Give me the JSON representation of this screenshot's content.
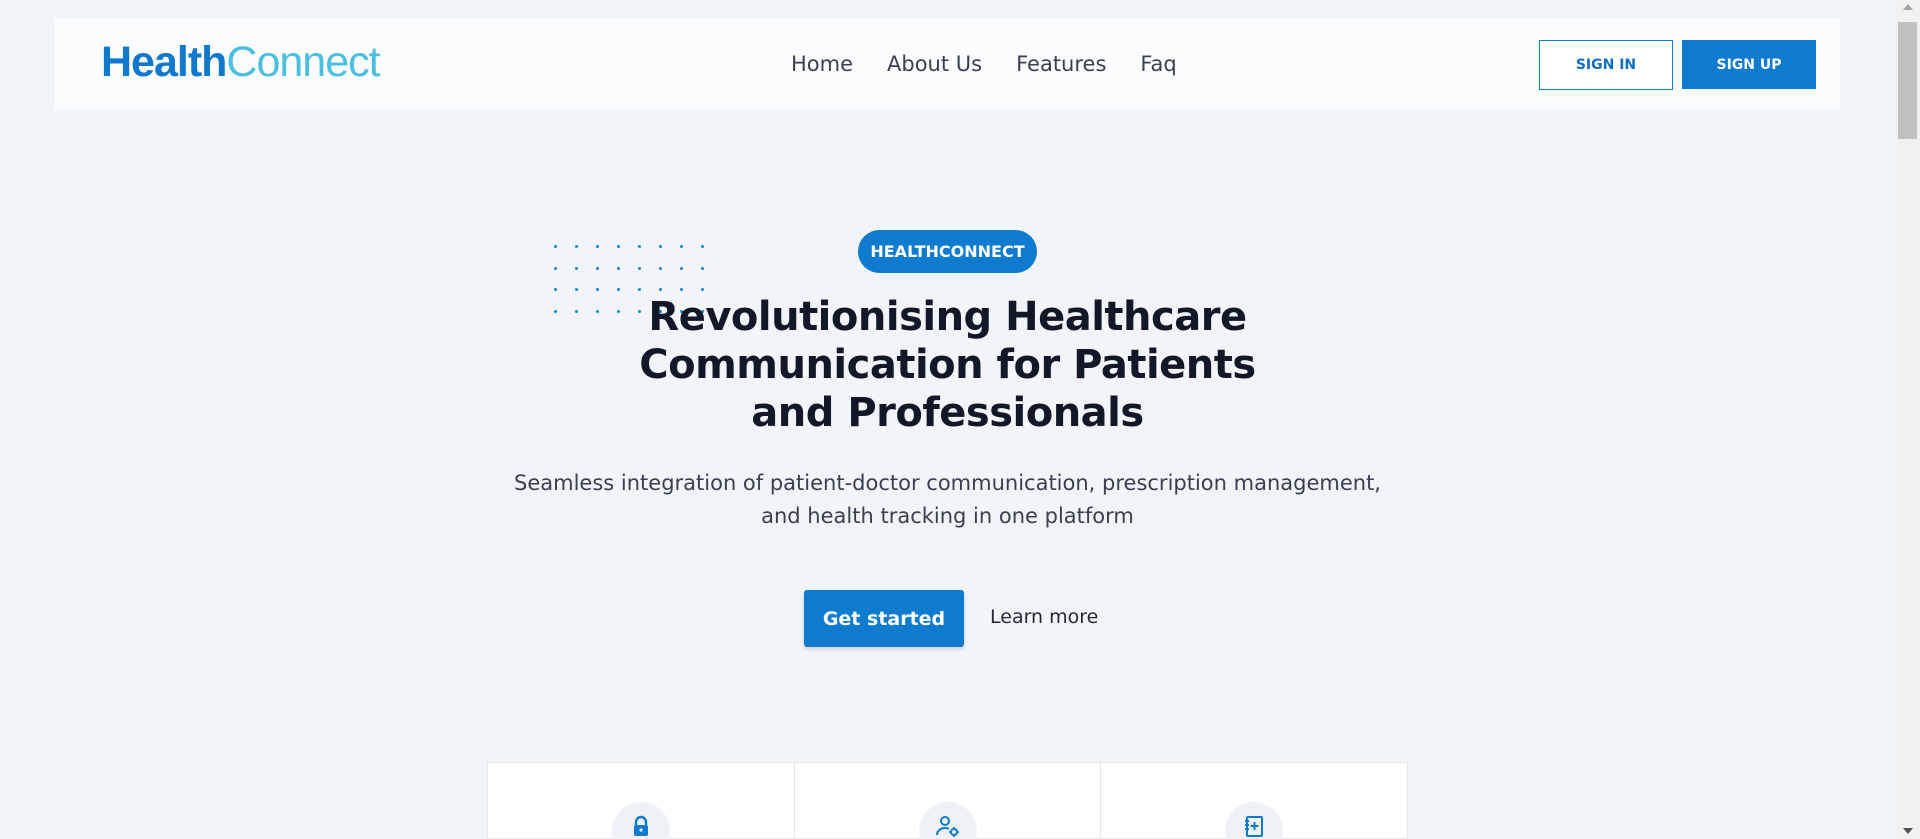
{
  "header": {
    "logo_part1": "Health",
    "logo_part2": "Connect",
    "nav": [
      {
        "label": "Home"
      },
      {
        "label": "About Us"
      },
      {
        "label": "Features"
      },
      {
        "label": "Faq"
      }
    ],
    "sign_in_label": "SIGN IN",
    "sign_up_label": "SIGN UP"
  },
  "hero": {
    "badge": "HEALTHCONNECT",
    "title_line1": "Revolutionising Healthcare",
    "title_line2": "Communication for Patients",
    "title_line3": "and Professionals",
    "subtitle_line1": "Seamless integration of patient-doctor communication, prescription management,",
    "subtitle_line2": "and health tracking in one platform",
    "primary_cta": "Get started",
    "secondary_cta": "Learn more"
  },
  "features": [
    {
      "icon": "lock-icon"
    },
    {
      "icon": "user-gear-icon"
    },
    {
      "icon": "notebook-plus-icon"
    }
  ],
  "colors": {
    "primary": "#0f7bcf",
    "logo_light": "#4bbfe0",
    "background": "#f1f4f8"
  }
}
